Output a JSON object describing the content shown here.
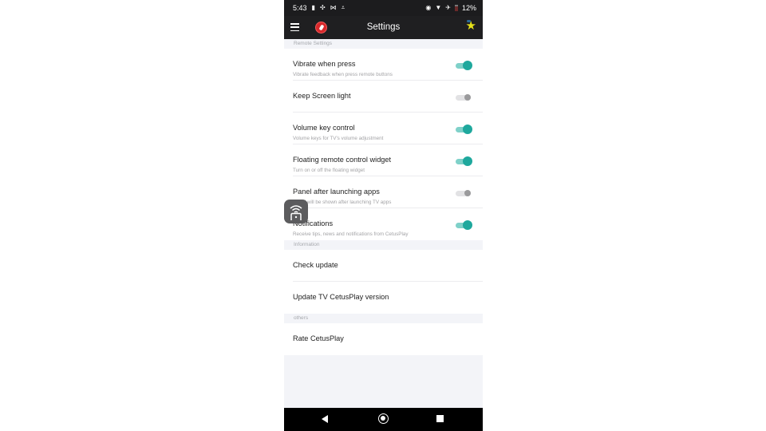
{
  "status_bar": {
    "time": "5:43",
    "left_icons": [
      "battery-saver-icon",
      "bug-icon",
      "mail-icon",
      "download-icon"
    ],
    "right_icons": [
      "vibrate-icon",
      "wifi-icon",
      "airplane-icon",
      "battery-icon"
    ],
    "battery_percent": "12%"
  },
  "app_bar": {
    "title": "Settings",
    "menu_icon": "menu-icon",
    "mic_icon": "mic-off-icon",
    "star_icon": "star-icon"
  },
  "sections": {
    "remote": {
      "header": "Remote Settings",
      "items": [
        {
          "title": "Vibrate when press",
          "subtitle": "Vibrate feedback when press remote buttons",
          "on": true
        },
        {
          "title": "Keep Screen light",
          "subtitle": "",
          "on": false
        },
        {
          "title": "Volume key control",
          "subtitle": "Volume keys for TV's volume adjustment",
          "on": true
        },
        {
          "title": "Floating remote control widget",
          "subtitle": "Turn on or off the floating widget",
          "on": true
        },
        {
          "title": "Panel after launching apps",
          "subtitle": "Panel will be shown after launching TV apps",
          "on": false
        },
        {
          "title": "Notifications",
          "subtitle": "Receive tips, news and notifications from CetusPlay",
          "on": true
        }
      ]
    },
    "information": {
      "header": "Information",
      "items": [
        {
          "title": "Check update"
        },
        {
          "title": "Update TV CetusPlay version"
        }
      ]
    },
    "others": {
      "header": "others",
      "items": [
        {
          "title": "Rate CetusPlay"
        }
      ]
    }
  },
  "floating_widget": {
    "icon": "remote-wifi-icon"
  },
  "nav_bar": {
    "back": "back-icon",
    "home": "home-icon",
    "recents": "recents-icon"
  },
  "colors": {
    "accent": "#1ea89d",
    "accent_track": "#7fd1c9",
    "appbar": "#1f1f21",
    "section_bg": "#f3f4f8"
  }
}
